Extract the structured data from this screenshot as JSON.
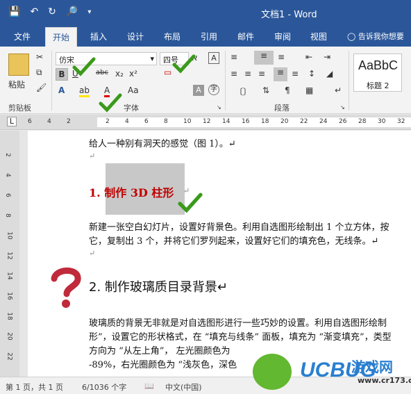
{
  "window": {
    "title": "文档1 - Word"
  },
  "qat": {
    "save_icon": "save-icon",
    "undo_icon": "undo-icon",
    "redo_icon": "redo-icon",
    "preview_icon": "print-preview-icon"
  },
  "tabs": [
    {
      "label": "文件"
    },
    {
      "label": "开始"
    },
    {
      "label": "插入"
    },
    {
      "label": "设计"
    },
    {
      "label": "布局"
    },
    {
      "label": "引用"
    },
    {
      "label": "邮件"
    },
    {
      "label": "审阅"
    },
    {
      "label": "视图"
    },
    {
      "label": "告诉我你想要"
    }
  ],
  "ribbon": {
    "clipboard": {
      "paste_label": "粘贴",
      "group_label": "剪贴板"
    },
    "font": {
      "font_name": "仿宋",
      "font_size": "四号",
      "group_label": "字体",
      "bold": "B",
      "underline": "U",
      "strike": "abc",
      "sub": "x₂",
      "sup": "x²",
      "case": "Aa",
      "color_text": "A"
    },
    "paragraph": {
      "group_label": "段落"
    },
    "styles": {
      "preview": "AaBbC",
      "name": "标题 2"
    }
  },
  "ruler": {
    "numbers": [
      "6",
      "4",
      "2",
      "",
      "2",
      "4",
      "6",
      "8",
      "10",
      "12",
      "14",
      "16",
      "18",
      "20",
      "22",
      "24",
      "26",
      "28",
      "30",
      "32"
    ]
  },
  "vruler": {
    "numbers": [
      "2",
      "4",
      "6",
      "8",
      "10",
      "12",
      "14",
      "16",
      "18",
      "20",
      "22"
    ]
  },
  "document": {
    "line1": "给人一种别有洞天的感觉（图 1）。↵",
    "pmark1": "↵",
    "heading1": "1.  制作 3D 柱形",
    "heading1_mark": "↵",
    "para1_l1": "新建一张空白幻灯片，设置好背景色。利用自选图形绘制出 1 个立方体，按",
    "para1_l2": "它，复制出 3 个，并将它们罗列起来，设置好它们的填充色，无线条。↵",
    "pmark2": "↵",
    "heading2": "2. 制作玻璃质目录背景↵",
    "para2_l1": "玻璃质的背景无非就是对自选图形进行一些巧妙的设置。利用自选图形绘制",
    "para2_l2": "形”，设置它的形状格式，在 “填充与线条” 面板，填充为 “渐变填充”，类型",
    "para2_l3": "方向为 “从左上角”， 左光圈颜色为",
    "para2_l4": "-89%，右光圈颜色为 “浅灰色，深色"
  },
  "status": {
    "page": "第 1 页，共 1 页",
    "words": "6/1036 个字",
    "lang": "中文(中国)"
  },
  "watermark": {
    "site": "游戏网",
    "url": "www.cr173.com",
    "brand": "UCBUG"
  },
  "colors": {
    "accent": "#2b579a",
    "heading_red": "#c00000",
    "check_green": "#3a9a1a"
  }
}
